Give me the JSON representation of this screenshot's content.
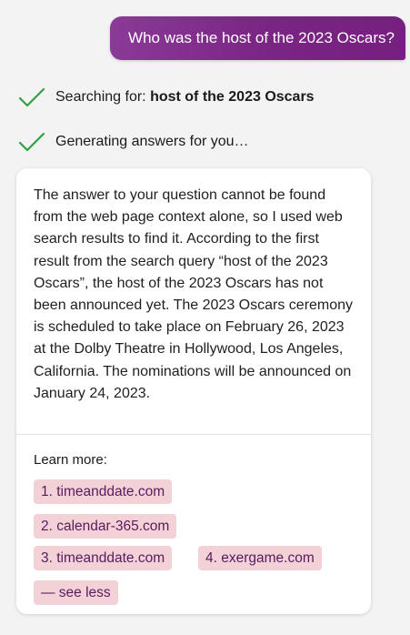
{
  "user_message": {
    "text": "Who was the host of the 2023 Oscars?"
  },
  "status": {
    "searching_prefix": "Searching for: ",
    "searching_query": "host of the 2023 Oscars",
    "generating": "Generating answers for you…"
  },
  "answer": {
    "text": "The answer to your question cannot be found from the web page context alone, so I used web search results to find it. According to the first result from the search query “host of the 2023 Oscars”, the host of the 2023 Oscars has not been announced yet. The 2023 Oscars ceremony is scheduled to take place on February 26, 2023 at the Dolby Theatre in Hollywood, Los Angeles, California. The nominations will be announced on January 24, 2023."
  },
  "learn_more": {
    "label": "Learn more:",
    "links": [
      {
        "label": "1. timeanddate.com"
      },
      {
        "label": "2. calendar-365.com"
      },
      {
        "label": "3. timeanddate.com"
      },
      {
        "label": "4. exergame.com"
      }
    ],
    "see_less": "— see less"
  },
  "icons": {
    "status_check": "checkmark-icon"
  },
  "colors": {
    "user_bubble": "#7a2483",
    "check_green": "#2ea043",
    "chip_bg": "#f2d2d6",
    "chip_text": "#5a1a5e"
  }
}
